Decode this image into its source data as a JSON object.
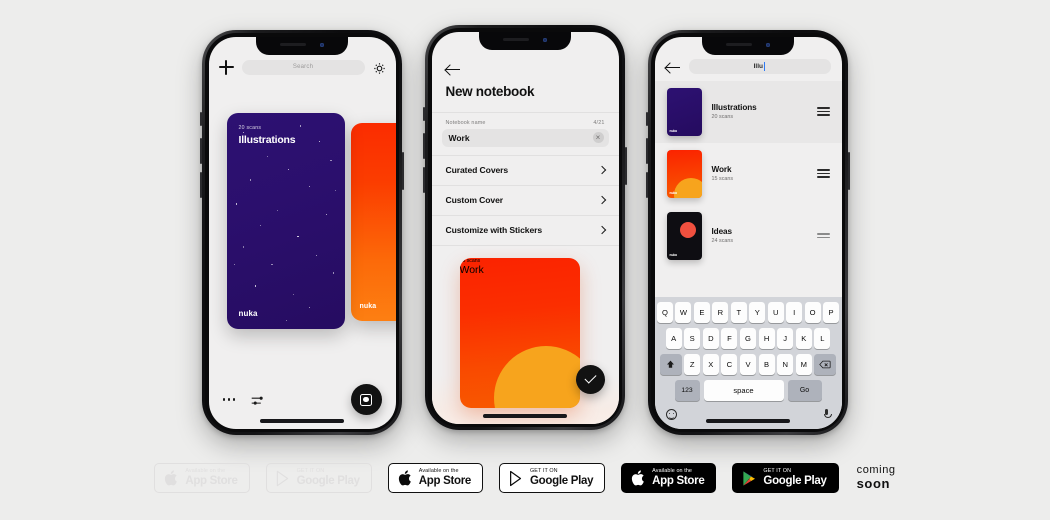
{
  "background_color": "#ededec",
  "phone1": {
    "name": "library-screen",
    "toolbar": {
      "add_icon": "plus-icon",
      "search_placeholder": "Search",
      "settings_icon": "gear-icon"
    },
    "cards": [
      {
        "title": "Illustrations",
        "scans": "20 scans",
        "brand": "nuka",
        "color": "#2d1172",
        "style": "navy-stars"
      },
      {
        "title": "",
        "scans": "",
        "brand": "nuka",
        "color": "#fb2c00",
        "style": "red-gradient"
      }
    ],
    "bottom": {
      "more_icon": "more-dots-icon",
      "filter_icon": "sliders-icon",
      "scan_icon": "scan-button"
    }
  },
  "phone2": {
    "name": "new-notebook-screen",
    "back_icon": "back-arrow-icon",
    "title": "New notebook",
    "field": {
      "label": "Notebook name",
      "counter": "4/21",
      "value": "Work",
      "clear_icon": "clear-icon"
    },
    "rows": [
      {
        "label": "Curated Covers"
      },
      {
        "label": "Custom Cover"
      },
      {
        "label": "Customize with Stickers"
      }
    ],
    "preview_card": {
      "title": "Work",
      "scans": "15 scans",
      "color": "#fb2300",
      "accent": "#f7a41d"
    },
    "confirm_icon": "check-button"
  },
  "phone3": {
    "name": "search-screen",
    "back_icon": "back-arrow-icon",
    "search_value": "Illu",
    "items": [
      {
        "name": "Illustrations",
        "scans": "20 scans",
        "color": "#2d1172",
        "brand": "nuka",
        "selected": true
      },
      {
        "name": "Work",
        "scans": "15 scans",
        "color": "#fb2300",
        "brand": "nuka",
        "selected": false
      },
      {
        "name": "Ideas",
        "scans": "24 scans",
        "color": "#0e0d12",
        "brand": "nuka",
        "selected": false
      }
    ],
    "keyboard": {
      "row1": [
        "Q",
        "W",
        "E",
        "R",
        "T",
        "Y",
        "U",
        "I",
        "O",
        "P"
      ],
      "row2": [
        "A",
        "S",
        "D",
        "F",
        "G",
        "H",
        "J",
        "K",
        "L"
      ],
      "row3": [
        "Z",
        "X",
        "C",
        "V",
        "B",
        "N",
        "M"
      ],
      "shift_icon": "shift-icon",
      "backspace_icon": "backspace-icon",
      "numbers_key": "123",
      "space_key": "space",
      "go_key": "Go",
      "emoji_icon": "emoji-icon",
      "mic_icon": "microphone-icon"
    }
  },
  "badges": [
    {
      "small": "Available on the",
      "large": "App Store",
      "icon": "apple-icon",
      "style": "ghost"
    },
    {
      "small": "GET IT ON",
      "large": "Google Play",
      "icon": "google-play-icon",
      "style": "ghost"
    },
    {
      "small": "Available on the",
      "large": "App Store",
      "icon": "apple-icon",
      "style": "outline"
    },
    {
      "small": "GET IT ON",
      "large": "Google Play",
      "icon": "google-play-icon",
      "style": "outline"
    },
    {
      "small": "Available on the",
      "large": "App Store",
      "icon": "apple-icon",
      "style": "solid"
    },
    {
      "small": "GET IT ON",
      "large": "Google Play",
      "icon": "google-play-icon",
      "style": "solid"
    }
  ],
  "coming_soon": {
    "line1": "coming",
    "line2": "soon"
  }
}
